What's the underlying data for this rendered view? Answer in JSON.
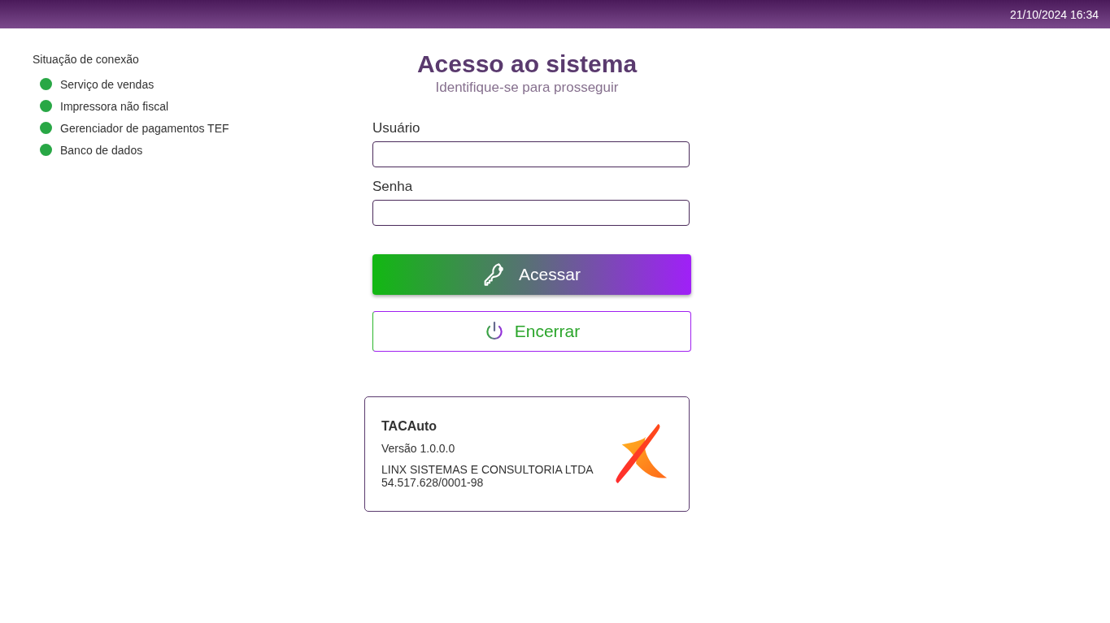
{
  "top_bar": {
    "datetime": "21/10/2024 16:34"
  },
  "connection_status": {
    "title": "Situação de conexão",
    "items": [
      {
        "label": "Serviço de vendas",
        "color": "#28a745"
      },
      {
        "label": "Impressora não fiscal",
        "color": "#28a745"
      },
      {
        "label": "Gerenciador de pagamentos TEF",
        "color": "#28a745"
      },
      {
        "label": "Banco de dados",
        "color": "#28a745"
      }
    ]
  },
  "login": {
    "title": "Acesso ao sistema",
    "subtitle": "Identifique-se para prosseguir",
    "fields": [
      {
        "label": "Usuário"
      },
      {
        "label": "Senha"
      }
    ],
    "buttons": [
      {
        "label": "Acessar",
        "kind": "primary"
      },
      {
        "label": "Encerrar",
        "kind": "secondary"
      }
    ]
  },
  "about": {
    "product": "TACAuto",
    "version": "Versão 1.0.0.0",
    "company": "LINX SISTEMAS E CONSULTORIA LTDA",
    "tax_id": "54.517.628/0001-98"
  }
}
